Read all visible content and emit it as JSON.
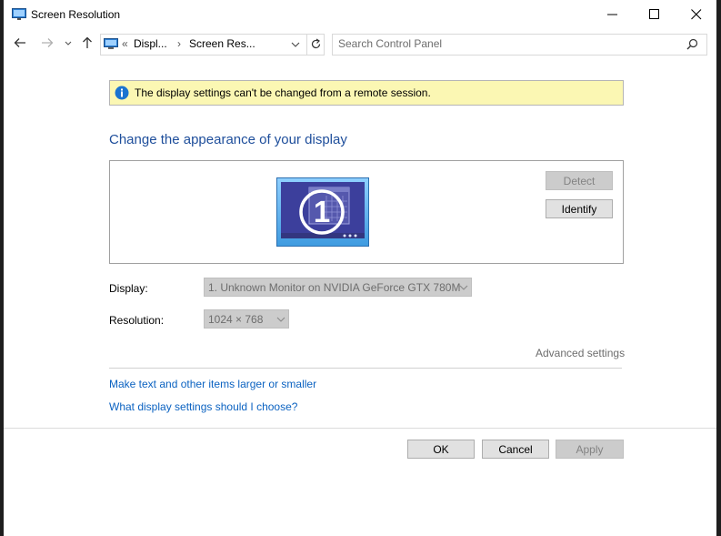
{
  "window": {
    "title": "Screen Resolution"
  },
  "address": {
    "crumb_prefix": "«",
    "crumb_1": "Displ...",
    "separator": "›",
    "crumb_2": "Screen Res..."
  },
  "search": {
    "placeholder": "Search Control Panel"
  },
  "info": {
    "message": "The display settings can't be changed from a remote session."
  },
  "heading": "Change the appearance of your display",
  "monitor": {
    "number": "1"
  },
  "buttons": {
    "detect": "Detect",
    "identify": "Identify",
    "ok": "OK",
    "cancel": "Cancel",
    "apply": "Apply"
  },
  "display": {
    "label": "Display:",
    "value": "1. Unknown Monitor on NVIDIA GeForce GTX 780M"
  },
  "resolution": {
    "label": "Resolution:",
    "value": "1024 × 768"
  },
  "advanced_settings": "Advanced settings",
  "links": {
    "text_size": "Make text and other items larger or smaller",
    "help": "What display settings should I choose?"
  },
  "colors": {
    "heading": "#1e4e9b",
    "link": "#0b62c1",
    "info_background": "#fbf7b3",
    "info_icon": "#1a73d0",
    "monitor_screen": "#3c3f9c"
  }
}
